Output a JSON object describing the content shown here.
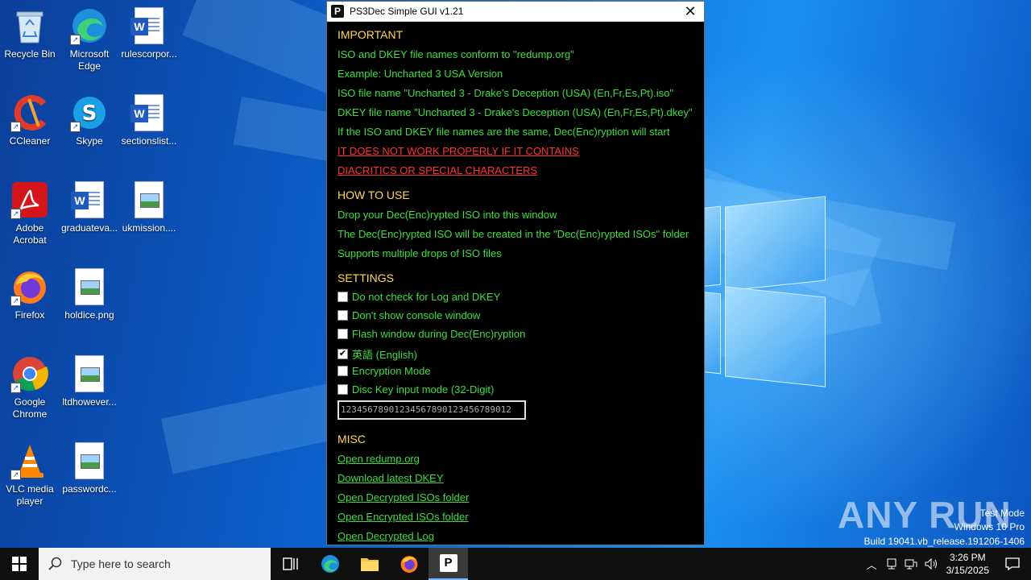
{
  "desktop": {
    "icons": [
      {
        "label": "Recycle Bin"
      },
      {
        "label": "Microsoft Edge"
      },
      {
        "label": "rulescorpor..."
      },
      {
        "label": "CCleaner"
      },
      {
        "label": "Skype"
      },
      {
        "label": "sectionslist..."
      },
      {
        "label": "Adobe Acrobat"
      },
      {
        "label": "graduateva..."
      },
      {
        "label": "ukmission...."
      },
      {
        "label": "Firefox"
      },
      {
        "label": "holdice.png"
      },
      {
        "label": "Google Chrome"
      },
      {
        "label": "ltdhowever..."
      },
      {
        "label": "VLC media player"
      },
      {
        "label": "passwordc..."
      }
    ]
  },
  "window": {
    "app_icon_letter": "P",
    "title": "PS3Dec Simple GUI v1.21",
    "close_glyph": "✕",
    "important": {
      "heading": "IMPORTANT",
      "lines": [
        "ISO and DKEY file names conform to \"redump.org\"",
        "Example: Uncharted 3 USA Version",
        "ISO file name \"Uncharted 3 - Drake's Deception (USA) (En,Fr,Es,Pt).iso\"",
        "DKEY file name \"Uncharted 3 - Drake's Deception (USA) (En,Fr,Es,Pt).dkey\"",
        "If the ISO and DKEY file names are the same, Dec(Enc)ryption will start"
      ],
      "warnings": [
        "IT DOES NOT WORK PROPERLY IF IT CONTAINS",
        "DIACRITICS OR SPECIAL CHARACTERS"
      ]
    },
    "how_to_use": {
      "heading": "HOW TO USE",
      "lines": [
        "Drop your Dec(Enc)rypted ISO into this window",
        "The Dec(Enc)rypted ISO will be created in the \"Dec(Enc)rypted ISOs\" folder",
        "Supports multiple drops of ISO files"
      ]
    },
    "settings": {
      "heading": "SETTINGS",
      "options": [
        {
          "label": "Do not check for Log and DKEY",
          "checked": false
        },
        {
          "label": "Don't show console window",
          "checked": false
        },
        {
          "label": "Flash window during Dec(Enc)ryption",
          "checked": false
        },
        {
          "label": "英語 (English)",
          "checked": true
        },
        {
          "label": "Encryption Mode",
          "checked": false
        },
        {
          "label": "Disc Key input mode (32-Digit)",
          "checked": false
        }
      ],
      "disc_key_value": "12345678901234567890123456789012"
    },
    "misc": {
      "heading": "MISC",
      "links": [
        "Open redump.org",
        "Download latest DKEY",
        "Open Decrypted ISOs folder",
        "Open Encrypted ISOs folder",
        "Open Decrypted Log"
      ]
    }
  },
  "watermark": {
    "brand": "ANY RUN",
    "mode": "Test Mode",
    "os": "Windows 10 Pro",
    "build": "Build 19041.vb_release.191206-1406"
  },
  "taskbar": {
    "search_placeholder": "Type here to search",
    "time": "3:26 PM",
    "date": "3/15/2025"
  },
  "colors": {
    "text_green": "#3dde3d",
    "heading_yellow": "#ffd75a",
    "warning_red": "#ff3333"
  }
}
